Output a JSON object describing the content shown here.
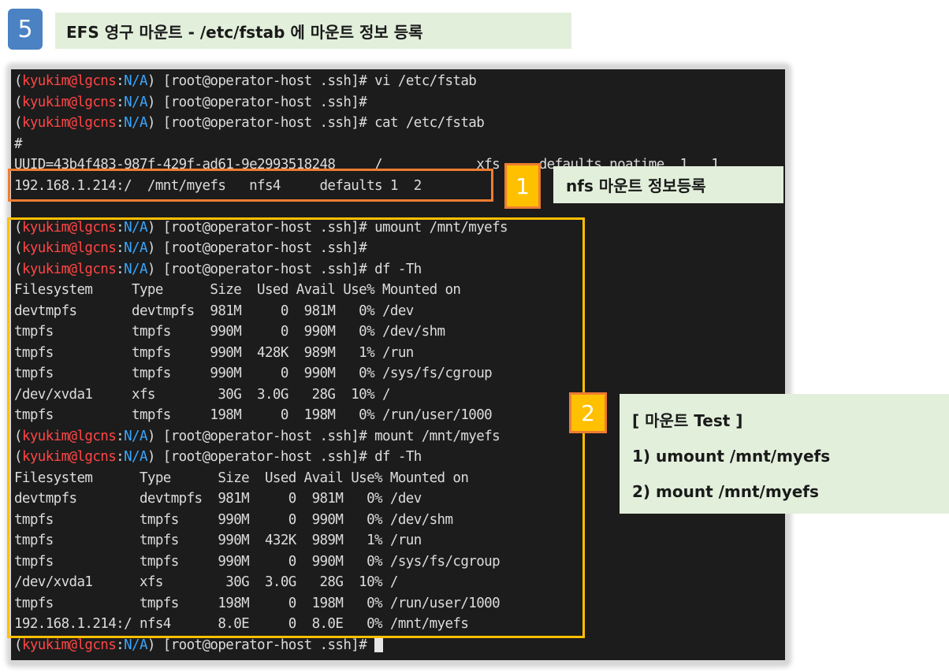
{
  "step": {
    "number": "5",
    "title": "EFS 영구 마운트 - /etc/fstab 에 마운트 정보 등록"
  },
  "terminal": {
    "prompt": {
      "open": "(",
      "user": "kyukim@lgcns",
      "colon": ":",
      "region": "N/A",
      "close": ")",
      "host": " [root@operator-host .ssh]#"
    },
    "lines": [
      {
        "prompt": true,
        "text": " vi /etc/fstab"
      },
      {
        "prompt": true,
        "text": ""
      },
      {
        "prompt": true,
        "text": " cat /etc/fstab"
      },
      {
        "prompt": false,
        "text": "#"
      },
      {
        "prompt": false,
        "text": "UUID=43b4f483-987f-429f-ad61-9e2993518248     /            xfs     defaults,noatime  1   1"
      },
      {
        "prompt": false,
        "text": "192.168.1.214:/  /mnt/myefs   nfs4     defaults 1  2"
      },
      {
        "prompt": false,
        "text": ""
      },
      {
        "prompt": true,
        "text": " umount /mnt/myefs"
      },
      {
        "prompt": true,
        "text": ""
      },
      {
        "prompt": true,
        "text": " df -Th"
      },
      {
        "prompt": false,
        "text": "Filesystem     Type      Size  Used Avail Use% Mounted on"
      },
      {
        "prompt": false,
        "text": "devtmpfs       devtmpfs  981M     0  981M   0% /dev"
      },
      {
        "prompt": false,
        "text": "tmpfs          tmpfs     990M     0  990M   0% /dev/shm"
      },
      {
        "prompt": false,
        "text": "tmpfs          tmpfs     990M  428K  989M   1% /run"
      },
      {
        "prompt": false,
        "text": "tmpfs          tmpfs     990M     0  990M   0% /sys/fs/cgroup"
      },
      {
        "prompt": false,
        "text": "/dev/xvda1     xfs        30G  3.0G   28G  10% /"
      },
      {
        "prompt": false,
        "text": "tmpfs          tmpfs     198M     0  198M   0% /run/user/1000"
      },
      {
        "prompt": true,
        "text": " mount /mnt/myefs"
      },
      {
        "prompt": true,
        "text": " df -Th"
      },
      {
        "prompt": false,
        "text": "Filesystem      Type      Size  Used Avail Use% Mounted on"
      },
      {
        "prompt": false,
        "text": "devtmpfs        devtmpfs  981M     0  981M   0% /dev"
      },
      {
        "prompt": false,
        "text": "tmpfs           tmpfs     990M     0  990M   0% /dev/shm"
      },
      {
        "prompt": false,
        "text": "tmpfs           tmpfs     990M  432K  989M   1% /run"
      },
      {
        "prompt": false,
        "text": "tmpfs           tmpfs     990M     0  990M   0% /sys/fs/cgroup"
      },
      {
        "prompt": false,
        "text": "/dev/xvda1      xfs        30G  3.0G   28G  10% /"
      },
      {
        "prompt": false,
        "text": "tmpfs           tmpfs     198M     0  198M   0% /run/user/1000"
      },
      {
        "prompt": false,
        "text": "192.168.1.214:/ nfs4      8.0E     0  8.0E   0% /mnt/myefs"
      },
      {
        "prompt": true,
        "text": " ",
        "cursor": true
      }
    ]
  },
  "callout1": {
    "number": "1",
    "label": "nfs 마운트 정보등록"
  },
  "callout2": {
    "number": "2",
    "title": "[ 마운트 Test ]",
    "items": [
      "1)  umount /mnt/myefs",
      "2)  mount /mnt/myefs"
    ]
  },
  "colors": {
    "user": "#ff4545",
    "region": "#3aa6ff",
    "box1_border": "#ee7d31",
    "box2_border": "#ffc000",
    "label_bg": "#e2efdb",
    "step_badge": "#4a82c3"
  }
}
